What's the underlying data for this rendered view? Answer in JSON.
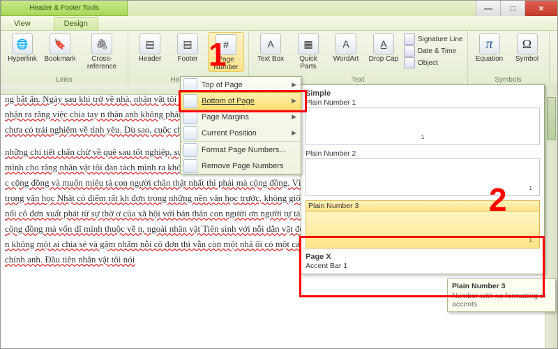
{
  "title": {
    "context_group": "Header & Footer Tools",
    "context_tab": "Design",
    "view_tab": "View"
  },
  "winbtns": {
    "min": "—",
    "max": "□",
    "close": "×"
  },
  "ribbon": {
    "links": {
      "hyperlink": "Hyperlink",
      "bookmark": "Bookmark",
      "crossref": "Cross-reference",
      "label": "Links"
    },
    "hf": {
      "header": "Header",
      "footer": "Footer",
      "pagenum": "Page Number",
      "label": "Header & F"
    },
    "text": {
      "textbox": "Text Box",
      "quickparts": "Quick Parts",
      "wordart": "WordArt",
      "dropcap": "Drop Cap",
      "sigline": "Signature Line",
      "datetime": "Date & Time",
      "object": "Object",
      "label": "Text"
    },
    "symbols": {
      "equation": "Equation",
      "symbol": "Symbol",
      "label": "Symbols",
      "pi": "π",
      "omega": "Ω"
    }
  },
  "menu": {
    "top": "Top of Page",
    "bottom": "Bottom of Page",
    "margins": "Page Margins",
    "current": "Current Position",
    "format": "Format Page Numbers...",
    "remove": "Remove Page Numbers"
  },
  "gallery": {
    "section": "Simple",
    "i1": "Plain Number 1",
    "i2": "Plain Number 2",
    "i3": "Plain Number 3",
    "pageX": "Page X",
    "accent": "Accent Bar 1",
    "sample": "1"
  },
  "tooltip": {
    "title": "Plain Number 3",
    "desc": "Number with no formatting or accents"
  },
  "ann": {
    "n1": "1",
    "n2": "2"
  },
  "doc": {
    "p1": "ng bắt ấn. Ngày sau khi trở về nhà, nhân vật tôi vẫn sắn gụi với mẹ, chi tiết này khiến chúng ta nhận ra rằng việc chia tay n thân anh không phải đang tách biệt mình với gia đình, vì anh i yêu, chưa có trải nghiệm về tình yêu. Dù sao, cuộc chia tay vẫn sự rung động.",
    "p2": "những chi tiết chấn chừ về quê sau tốt nghiệp, sự xa cách với ông có trải nghiệm về tình yêu, mình cho rằng nhân vật tôi đan tách mình ra khỏi gia đình và cộng đồng của anh. Đầu tiên, người c cộng đồng và muốn miêu tả con người chân thật nhất thì phải mà cộng đồng. Vì vậy sự cô đơn trong văn học Nhật có điểm rất kh đơn trong những nền văn học trước, không giống nhân vật Mei nối cô đơn xuất phát từ sự thờ ơ của xã hội với bản thân con người ơn người tự tách mình khỏi cộng đồng mà vốn dĩ mình thuộc về n, ngoài nhân vật Tiên sinh với nỗi dằn vặt đến ngờ vực, tách n không một ai chia sẻ và gặm nhấm nỗi cô đơn thì vẫn còn một nhâ ối có một cảm giác cô đơn chính anh. Đầu tiên nhân vật tôi nói"
  }
}
